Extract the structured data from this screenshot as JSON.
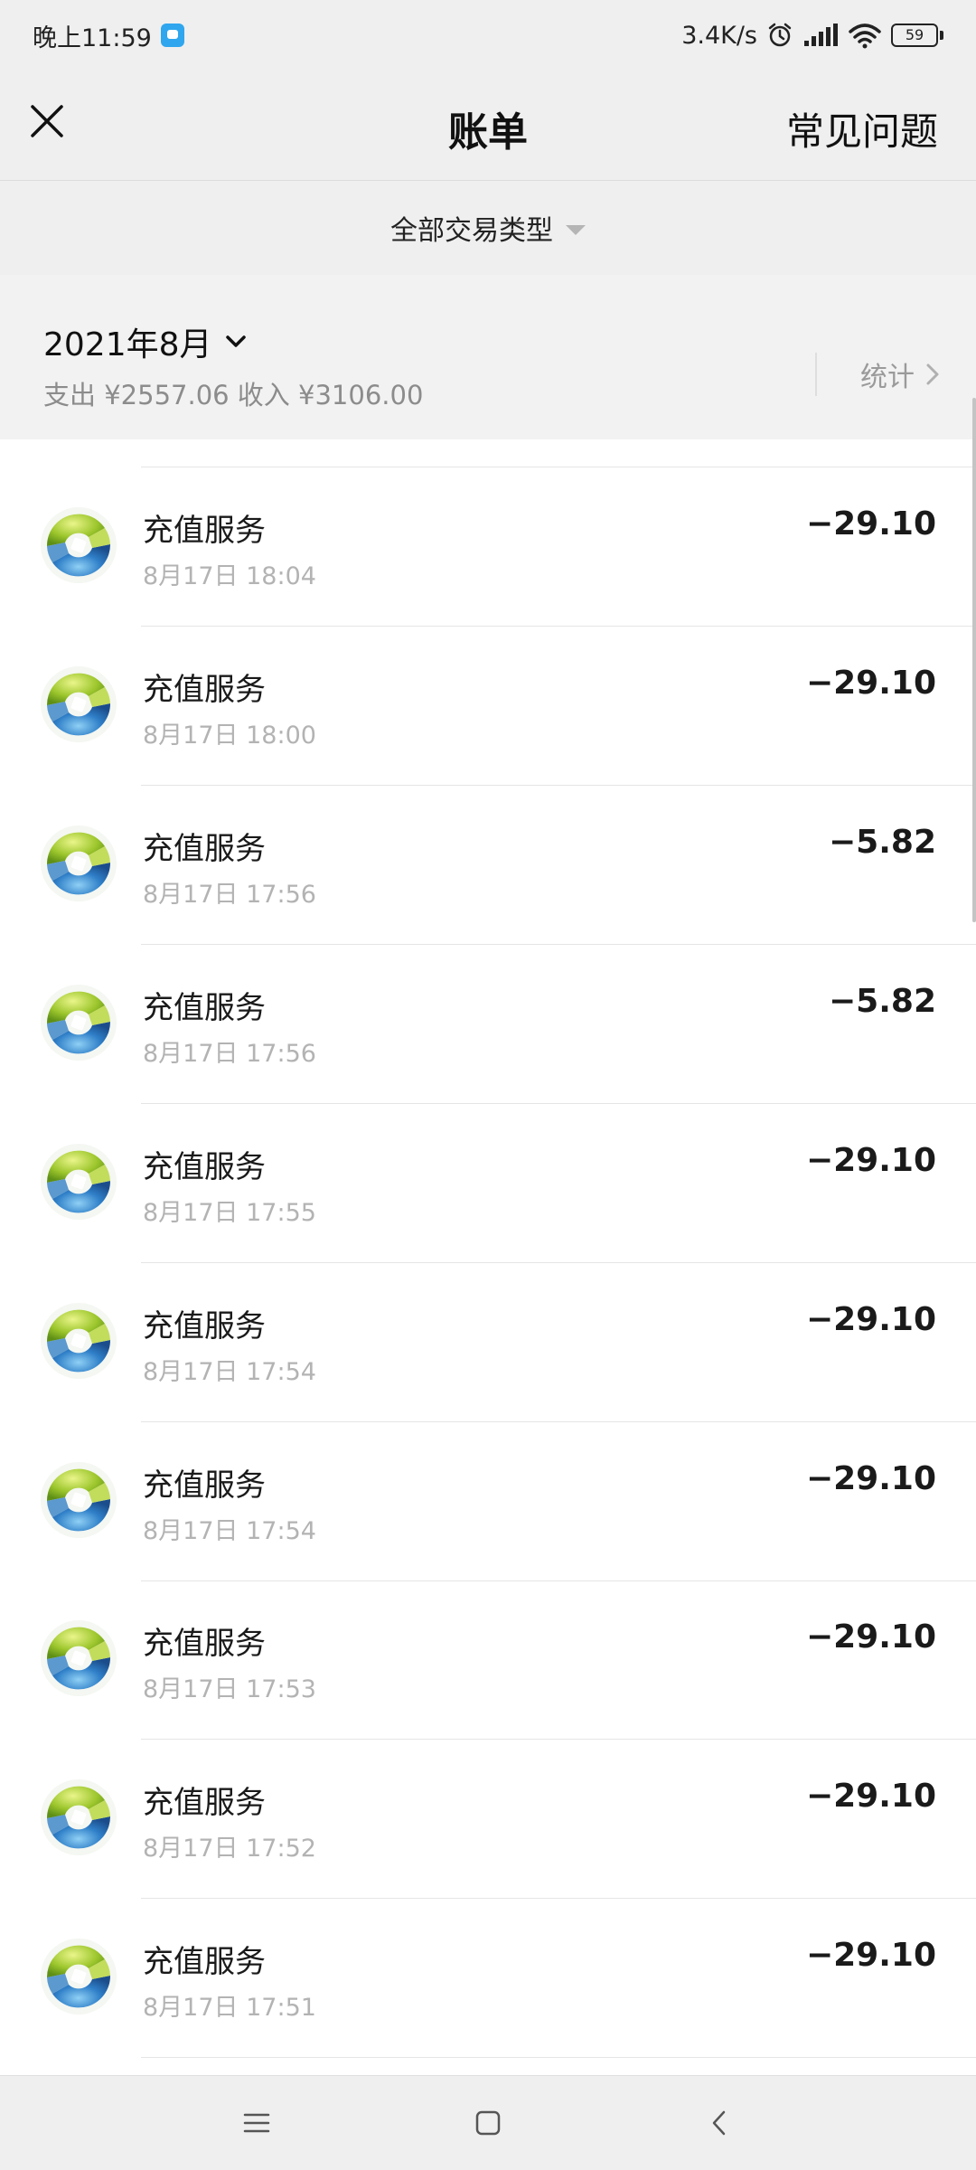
{
  "status_bar": {
    "time": "晚上11:59",
    "network_speed": "3.4K/s",
    "battery": "59",
    "icons": [
      "chat-notification-icon",
      "alarm-icon",
      "signal-icon",
      "wifi-icon",
      "battery-icon"
    ]
  },
  "header": {
    "title": "账单",
    "faq_label": "常见问题",
    "close_icon": "close-icon"
  },
  "filter": {
    "label": "全部交易类型"
  },
  "month_section": {
    "month": "2021年8月",
    "summary": "支出 ¥2557.06 收入 ¥3106.00",
    "stats_label": "统计"
  },
  "transactions": [
    {
      "title": "充值服务",
      "time": "8月17日 18:04",
      "amount": "−29.10"
    },
    {
      "title": "充值服务",
      "time": "8月17日 18:00",
      "amount": "−29.10"
    },
    {
      "title": "充值服务",
      "time": "8月17日 17:56",
      "amount": "−5.82"
    },
    {
      "title": "充值服务",
      "time": "8月17日 17:56",
      "amount": "−5.82"
    },
    {
      "title": "充值服务",
      "time": "8月17日 17:55",
      "amount": "−29.10"
    },
    {
      "title": "充值服务",
      "time": "8月17日 17:54",
      "amount": "−29.10"
    },
    {
      "title": "充值服务",
      "time": "8月17日 17:54",
      "amount": "−29.10"
    },
    {
      "title": "充值服务",
      "time": "8月17日 17:53",
      "amount": "−29.10"
    },
    {
      "title": "充值服务",
      "time": "8月17日 17:52",
      "amount": "−29.10"
    },
    {
      "title": "充值服务",
      "time": "8月17日 17:51",
      "amount": "−29.10"
    }
  ],
  "nav_bar": {
    "icons": [
      "menu-icon",
      "home-icon",
      "back-icon"
    ]
  }
}
